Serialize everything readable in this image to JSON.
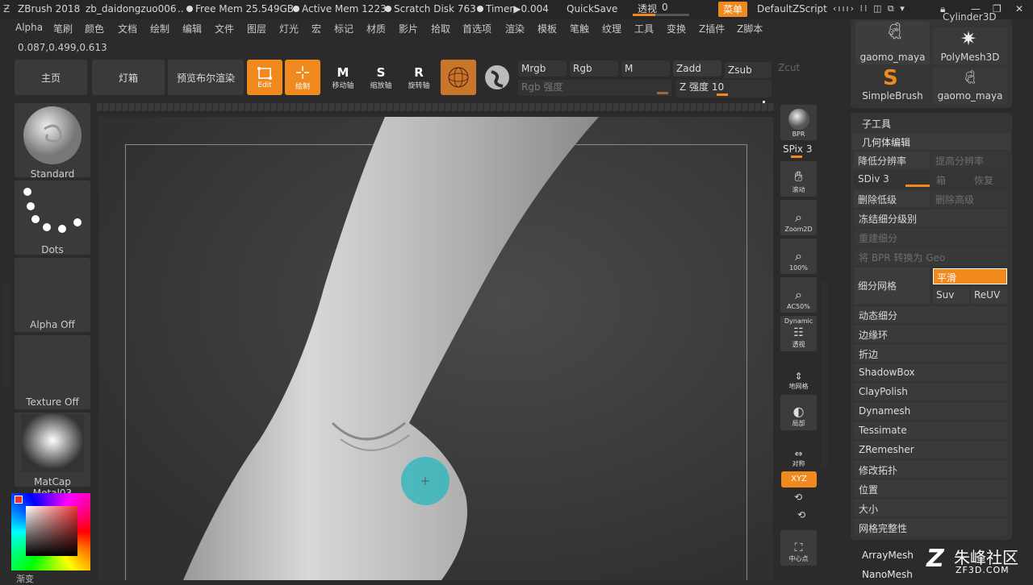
{
  "titlebar": {
    "app": "ZBrush 2018",
    "file": "zb_daidongzuo006",
    "ellipsis": "..",
    "free_mem": "Free Mem 25.549GB",
    "active_mem": "Active Mem 1223",
    "scratch": "Scratch Disk 763",
    "timer": "Timer▶0.004",
    "quicksave": "QuickSave",
    "persp_label": "透视",
    "persp_value": "0",
    "menu_btn": "菜单",
    "script": "DefaultZScript"
  },
  "menu": [
    "Alpha",
    "笔刷",
    "颜色",
    "文档",
    "绘制",
    "编辑",
    "文件",
    "图层",
    "灯光",
    "宏",
    "标记",
    "材质",
    "影片",
    "拾取",
    "首选项",
    "渲染",
    "模板",
    "笔触",
    "纹理",
    "工具",
    "变换",
    "Z插件",
    "Z脚本"
  ],
  "coords": "0.087,0.499,0.613",
  "toolbar": {
    "home": "主页",
    "lightbox": "灯箱",
    "bpr_preview": "预览布尔渲染",
    "edit": "Edit",
    "draw": "绘制",
    "move": "移动轴",
    "scale": "缩放轴",
    "rotate": "旋转轴",
    "move_letter": "M",
    "scale_letter": "S",
    "rotate_letter": "R"
  },
  "mrgb": {
    "mrgb": "Mrgb",
    "rgb": "Rgb",
    "m": "M",
    "zadd": "Zadd",
    "zsub": "Zsub",
    "zcut": "Zcut",
    "rgb_intensity": "Rgb 强度",
    "z_intensity": "Z 强度 10"
  },
  "left": {
    "brush": "Standard",
    "stroke": "Dots",
    "alpha": "Alpha Off",
    "texture": "Texture Off",
    "material": "MatCap Metal03",
    "gradient": "渐变"
  },
  "right_tools": {
    "bpr": "BPR",
    "spix": "SPix 3",
    "scroll": "滚动",
    "zoom2d": "Zoom2D",
    "zoom100": "100%",
    "ac50": "AC50%",
    "dynamic": "Dynamic",
    "persp": "透视",
    "floor": "地网格",
    "local": "局部",
    "sym": "对称",
    "xyz": "XYZ",
    "center": "中心点"
  },
  "subtool_tiles": [
    "gaomo_maya",
    "PolyMesh3D",
    "SimpleBrush",
    "gaomo_maya"
  ],
  "subtool_top": "Cylinder3D",
  "geom": {
    "subtool": "子工具",
    "geom_edit": "几何体编辑",
    "lower_res": "降低分辨率",
    "higher_res": "提高分辨率",
    "sdiv": "SDiv 3",
    "cage": "箱",
    "restore": "恢复",
    "del_lower": "删除低级",
    "del_higher": "删除高级",
    "freeze": "冻结细分级别",
    "rebuild": "重建细分",
    "bpr_to_geo": "将 BPR 转换为 Geo",
    "divide": "细分网格",
    "smooth": "平滑",
    "suv": "Suv",
    "reuv": "ReUV",
    "items": [
      "动态细分",
      "边缘环",
      "折边",
      "ShadowBox",
      "ClayPolish",
      "Dynamesh",
      "Tessimate",
      "ZRemesher",
      "修改拓扑",
      "位置",
      "大小",
      "网格完整性"
    ],
    "arraymesh": "ArrayMesh",
    "nanomesh": "NanoMesh"
  },
  "watermark": {
    "brand": "朱峰社区",
    "url": "ZF3D.COM"
  },
  "colors": {
    "accent": "#f08a1f",
    "bg": "#2b2b2b",
    "panel": "#353535"
  }
}
